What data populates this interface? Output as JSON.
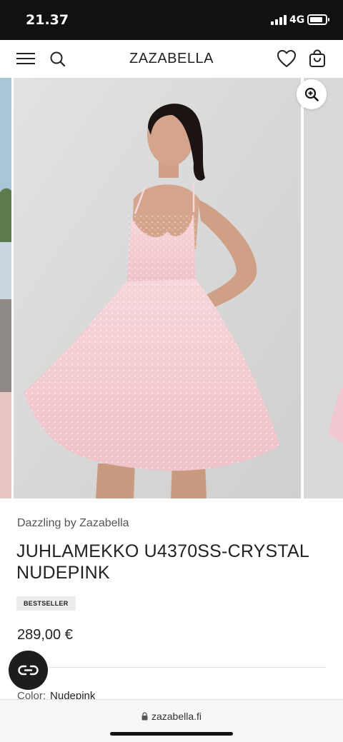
{
  "status": {
    "time": "21.37",
    "network": "4G",
    "battery_level": 0.85
  },
  "header": {
    "logo": "ZAZABELLA",
    "icons": {
      "menu": "hamburger-menu-icon",
      "search": "search-icon",
      "wishlist": "heart-icon",
      "cart": "shopping-bag-icon"
    }
  },
  "gallery": {
    "zoom_icon": "zoom-in-icon",
    "image_description": "product-photo-pink-sequin-dress"
  },
  "product": {
    "brand": "Dazzling by Zazabella",
    "title": "JUHLAMEKKO U4370SS-CRYSTAL NUDEPINK",
    "badge": "BESTSELLER",
    "price": "289,00 €",
    "color_label": "Color:",
    "color_value": "Nudepink"
  },
  "chat": {
    "icon": "chat-link-icon"
  },
  "browser": {
    "url": "zazabella.fi",
    "lock_icon": "lock-icon"
  },
  "colors": {
    "status_bg": "#111111",
    "dress_pink": "#f3c9cf",
    "image_bg": "#dcdcdc",
    "badge_bg": "#ededed"
  }
}
